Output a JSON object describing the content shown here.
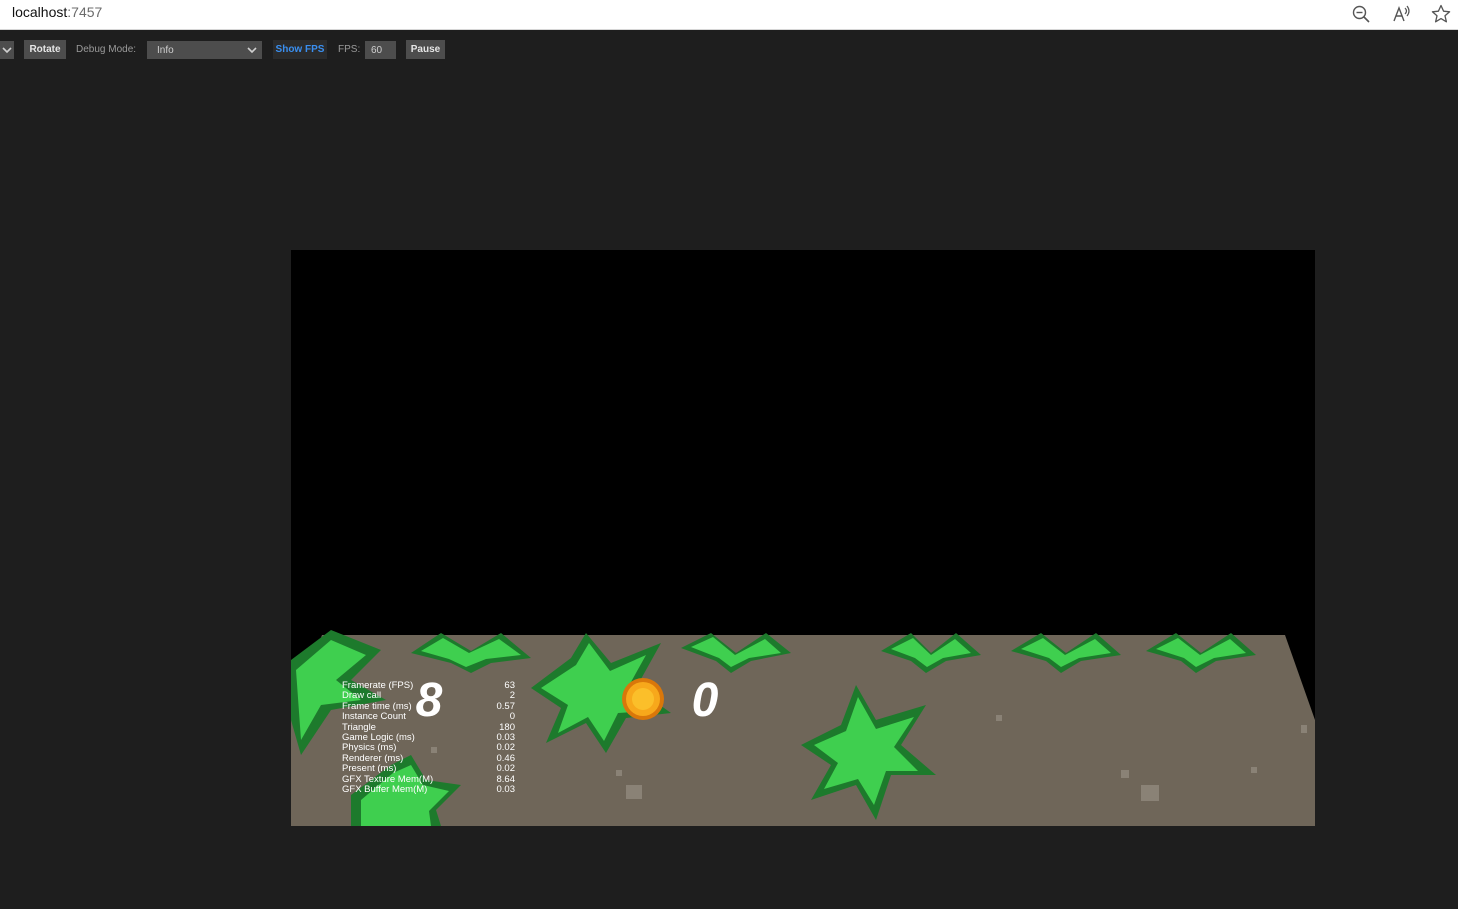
{
  "browser": {
    "url_host": "localhost",
    "url_port": ":7457",
    "icons": [
      "zoom-out-icon",
      "read-aloud-icon",
      "favorite-star-icon"
    ]
  },
  "toolbar": {
    "rotate_label": "Rotate",
    "debug_mode_label": "Debug Mode:",
    "debug_mode_value": "Info",
    "show_fps_label": "Show FPS",
    "fps_label": "FPS:",
    "fps_value": "60",
    "pause_label": "Pause"
  },
  "game": {
    "score_left": "8",
    "score_right": "0",
    "stats": [
      {
        "label": "Framerate (FPS)",
        "value": "63"
      },
      {
        "label": "Draw call",
        "value": "2"
      },
      {
        "label": "Frame time (ms)",
        "value": "0.57"
      },
      {
        "label": "Instance Count",
        "value": "0"
      },
      {
        "label": "Triangle",
        "value": "180"
      },
      {
        "label": "Game Logic (ms)",
        "value": "0.03"
      },
      {
        "label": "Physics (ms)",
        "value": "0.02"
      },
      {
        "label": "Renderer (ms)",
        "value": "0.46"
      },
      {
        "label": "Present (ms)",
        "value": "0.02"
      },
      {
        "label": "GFX Texture Mem(M)",
        "value": "8.64"
      },
      {
        "label": "GFX Buffer Mem(M)",
        "value": "0.03"
      }
    ]
  },
  "colors": {
    "page_bg": "#1e1e1e",
    "toolbar_button": "#4d4d4d",
    "show_fps_text": "#3a8ff0",
    "ground": "#6f6659",
    "leaf_dark": "#1d7a2c",
    "leaf_light": "#3fcf4f",
    "coin": "#f7a81b"
  }
}
